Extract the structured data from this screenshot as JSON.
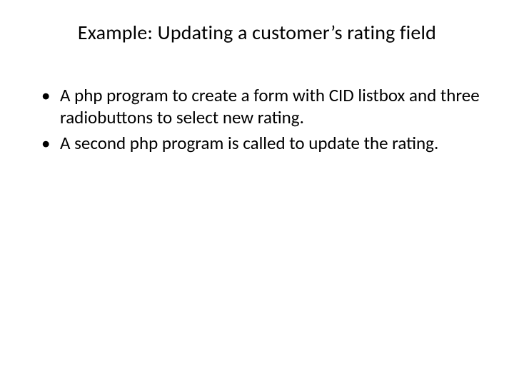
{
  "title": "Example: Updating a customer’s rating field",
  "bullets": [
    "A php program to create a form with CID listbox and three radiobuttons to select new rating.",
    "A second php program is called to update the rating."
  ]
}
